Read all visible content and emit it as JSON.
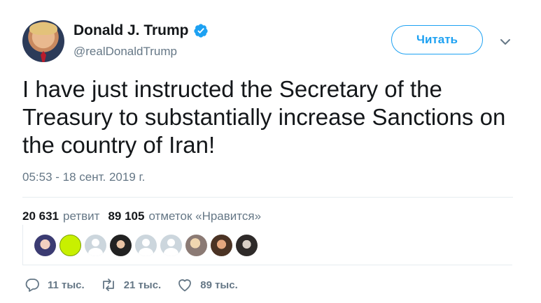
{
  "author": {
    "name": "Donald J. Trump",
    "handle": "@realDonaldTrump",
    "verified": true
  },
  "follow_button": {
    "label": "Читать"
  },
  "tweet": {
    "text": "I have just instructed the Secretary of the Treasury to substantially increase Sanctions on the country of Iran!",
    "timestamp": "05:53 - 18 сент. 2019 г."
  },
  "stats": {
    "retweets_count": "20 631",
    "retweets_label": "ретвит",
    "likes_count": "89 105",
    "likes_label": "отметок «Нравится»"
  },
  "liker_avatars": [
    {
      "name": "liker-avatar-1"
    },
    {
      "name": "liker-avatar-2"
    },
    {
      "name": "liker-avatar-3"
    },
    {
      "name": "liker-avatar-4"
    },
    {
      "name": "liker-avatar-5"
    },
    {
      "name": "liker-avatar-6"
    },
    {
      "name": "liker-avatar-7"
    },
    {
      "name": "liker-avatar-8"
    },
    {
      "name": "liker-avatar-9"
    }
  ],
  "actions": {
    "reply_count": "11 тыс.",
    "retweet_count": "21 тыс.",
    "like_count": "89 тыс."
  },
  "colors": {
    "accent": "#1da1f2",
    "text": "#14171a",
    "muted": "#657786",
    "divider": "#e6ecf0"
  },
  "icons": [
    "verified-badge-icon",
    "chevron-down-icon",
    "reply-icon",
    "retweet-icon",
    "like-icon"
  ]
}
